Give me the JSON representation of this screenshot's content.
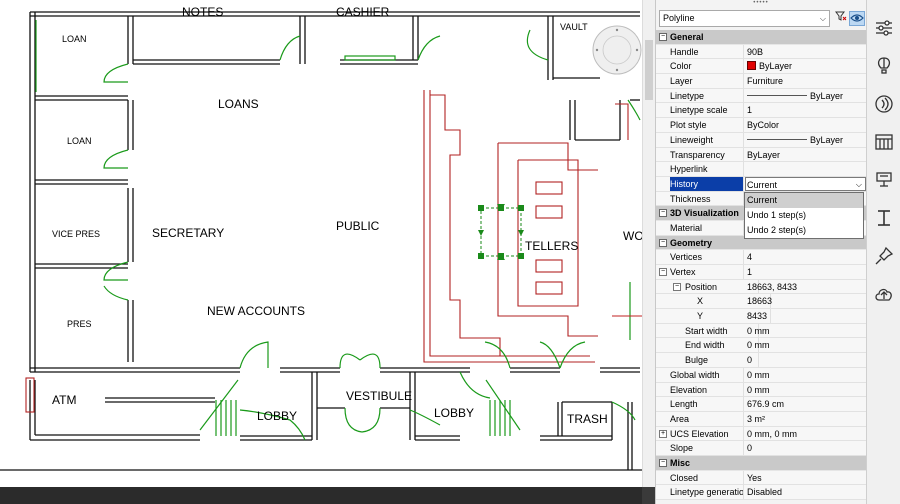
{
  "drawing": {
    "rooms": {
      "notes": "NOTES",
      "cashier": "CASHIER",
      "vault": "VAULT",
      "loan1": "LOAN",
      "loan2": "LOAN",
      "vice_pres": "VICE PRES",
      "pres": "PRES",
      "loans": "LOANS",
      "secretary": "SECRETARY",
      "public": "PUBLIC",
      "new_accounts": "NEW ACCOUNTS",
      "tellers": "TELLERS",
      "work": "WORK",
      "atm": "ATM",
      "lobby_left": "LOBBY",
      "vestibule": "VESTIBULE",
      "lobby_right": "LOBBY",
      "trash": "TRASH"
    }
  },
  "properties": {
    "object_type": "Polyline",
    "sections": {
      "general": "General",
      "visualization": "3D Visualization",
      "geometry": "Geometry",
      "misc": "Misc"
    },
    "general": {
      "handle": {
        "k": "Handle",
        "v": "90B"
      },
      "color": {
        "k": "Color",
        "v": "ByLayer",
        "swatch": "#e00000"
      },
      "layer": {
        "k": "Layer",
        "v": "Furniture"
      },
      "linetype": {
        "k": "Linetype",
        "v": "ByLayer"
      },
      "linetype_scale": {
        "k": "Linetype scale",
        "v": "1"
      },
      "plot_style": {
        "k": "Plot style",
        "v": "ByColor"
      },
      "lineweight": {
        "k": "Lineweight",
        "v": "ByLayer"
      },
      "transparency": {
        "k": "Transparency",
        "v": "ByLayer"
      },
      "hyperlink": {
        "k": "Hyperlink",
        "v": ""
      },
      "history": {
        "k": "History",
        "v": "Current"
      },
      "thickness": {
        "k": "Thickness",
        "v": ""
      }
    },
    "visualization": {
      "material": {
        "k": "Material",
        "v": ""
      }
    },
    "geometry": {
      "vertices": {
        "k": "Vertices",
        "v": "4"
      },
      "vertex": {
        "k": "Vertex",
        "v": "1"
      },
      "position": {
        "k": "Position",
        "v": "18663, 8433"
      },
      "x": {
        "k": "X",
        "v": "18663"
      },
      "y": {
        "k": "Y",
        "v": "8433"
      },
      "start_width": {
        "k": "Start width",
        "v": "0 mm"
      },
      "end_width": {
        "k": "End width",
        "v": "0 mm"
      },
      "bulge": {
        "k": "Bulge",
        "v": "0"
      },
      "global_width": {
        "k": "Global width",
        "v": "0 mm"
      },
      "elevation": {
        "k": "Elevation",
        "v": "0 mm"
      },
      "length": {
        "k": "Length",
        "v": "676.9 cm"
      },
      "area": {
        "k": "Area",
        "v": "3 m²"
      },
      "ucs_elevation": {
        "k": "UCS Elevation",
        "v": "0 mm, 0 mm"
      },
      "slope": {
        "k": "Slope",
        "v": "0"
      }
    },
    "misc": {
      "closed": {
        "k": "Closed",
        "v": "Yes"
      },
      "linetype_generation": {
        "k": "Linetype generation",
        "v": "Disabled"
      }
    },
    "history_options": [
      "Current",
      "Undo 1 step(s)",
      "Undo 2 step(s)"
    ]
  },
  "toolstrip": [
    "properties-panel-icon",
    "hot-air-balloon-icon",
    "signal-icon",
    "library-icon",
    "stamp-icon",
    "i-beam-icon",
    "pin-icon",
    "cloud-upload-icon"
  ]
}
